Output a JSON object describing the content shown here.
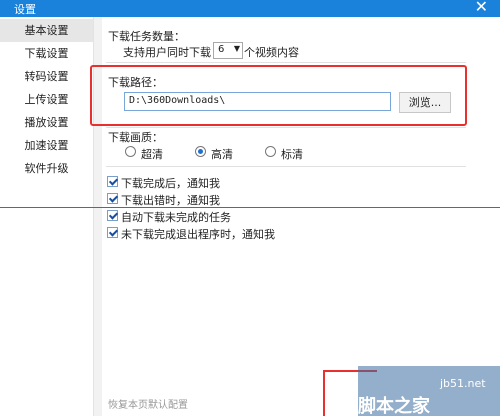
{
  "window": {
    "title": "设置",
    "close_symbol": "✕"
  },
  "sidebar": {
    "items": [
      {
        "label": "基本设置",
        "active": true
      },
      {
        "label": "下载设置",
        "active": false
      },
      {
        "label": "转码设置",
        "active": false
      },
      {
        "label": "上传设置",
        "active": false
      },
      {
        "label": "播放设置",
        "active": false
      },
      {
        "label": "加速设置",
        "active": false
      },
      {
        "label": "软件升级",
        "active": false
      }
    ]
  },
  "download": {
    "task_count_title": "下载任务数量：",
    "concurrent_prefix": "支持用户同时下载",
    "concurrent_value": "6",
    "concurrent_suffix": "个视频内容",
    "path_title": "下载路径：",
    "path_value": "D:\\360Downloads\\",
    "browse_label": "浏览...",
    "quality_title": "下载画质：",
    "quality_options": [
      {
        "label": "超清",
        "selected": false
      },
      {
        "label": "高清",
        "selected": true
      },
      {
        "label": "标清",
        "selected": false
      }
    ],
    "checkboxes": [
      {
        "label": "下载完成后，通知我",
        "checked": true
      },
      {
        "label": "下载出错时，通知我",
        "checked": true
      },
      {
        "label": "自动下载未完成的任务",
        "checked": true
      },
      {
        "label": "未下载完成退出程序时，通知我",
        "checked": true
      }
    ],
    "restore_label": "恢复本页默认配置"
  },
  "watermark": {
    "site": "jb51.net",
    "text": "脚本之家"
  },
  "colors": {
    "title_bar": "#1b82dc",
    "highlight_red": "#e8302f",
    "sidebar_active": "#e6e6e6"
  }
}
